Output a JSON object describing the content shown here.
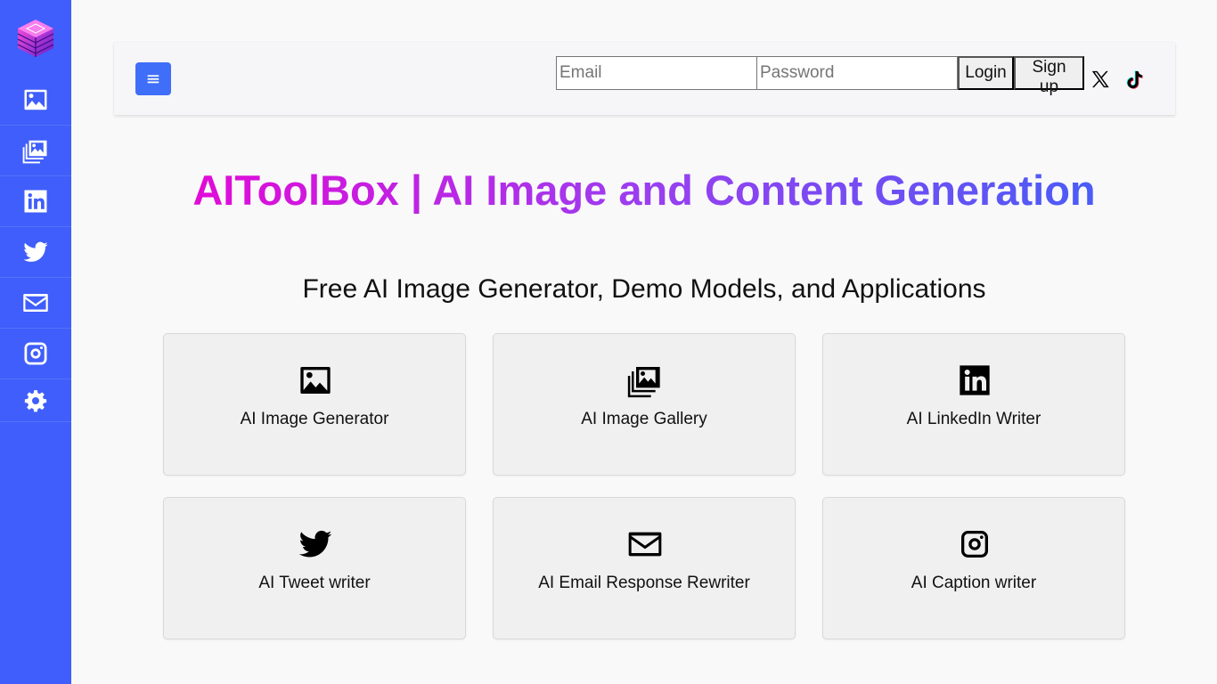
{
  "sidebar": {
    "logo_icon": "cube-stack-logo-icon",
    "items": [
      {
        "icon": "image-icon"
      },
      {
        "icon": "gallery-icon"
      },
      {
        "icon": "linkedin-icon"
      },
      {
        "icon": "twitter-icon"
      },
      {
        "icon": "envelope-icon"
      },
      {
        "icon": "instagram-icon"
      },
      {
        "icon": "gear-icon"
      }
    ],
    "background": "#3f5efb"
  },
  "header": {
    "menu_icon": "≡",
    "email_placeholder": "Email",
    "email_value": "",
    "password_placeholder": "Password",
    "password_value": "",
    "login_label": "Login",
    "signup_label": "Sign up",
    "social_icons": [
      "x-icon",
      "tiktok-icon"
    ]
  },
  "main": {
    "title": "AIToolBox | AI Image and Content Generation",
    "title_gradient": [
      "#e20ad8",
      "#9b3ef0",
      "#4a5cf7"
    ],
    "subtitle": "Free AI Image Generator, Demo Models, and Applications",
    "cards": [
      {
        "label": "AI Image Generator",
        "icon": "image-icon"
      },
      {
        "label": "AI Image Gallery",
        "icon": "gallery-icon"
      },
      {
        "label": "AI LinkedIn Writer",
        "icon": "linkedin-icon"
      },
      {
        "label": "AI Tweet writer",
        "icon": "twitter-icon"
      },
      {
        "label": "AI Email Response Rewriter",
        "icon": "envelope-icon"
      },
      {
        "label": "AI Caption writer",
        "icon": "instagram-icon"
      }
    ]
  }
}
